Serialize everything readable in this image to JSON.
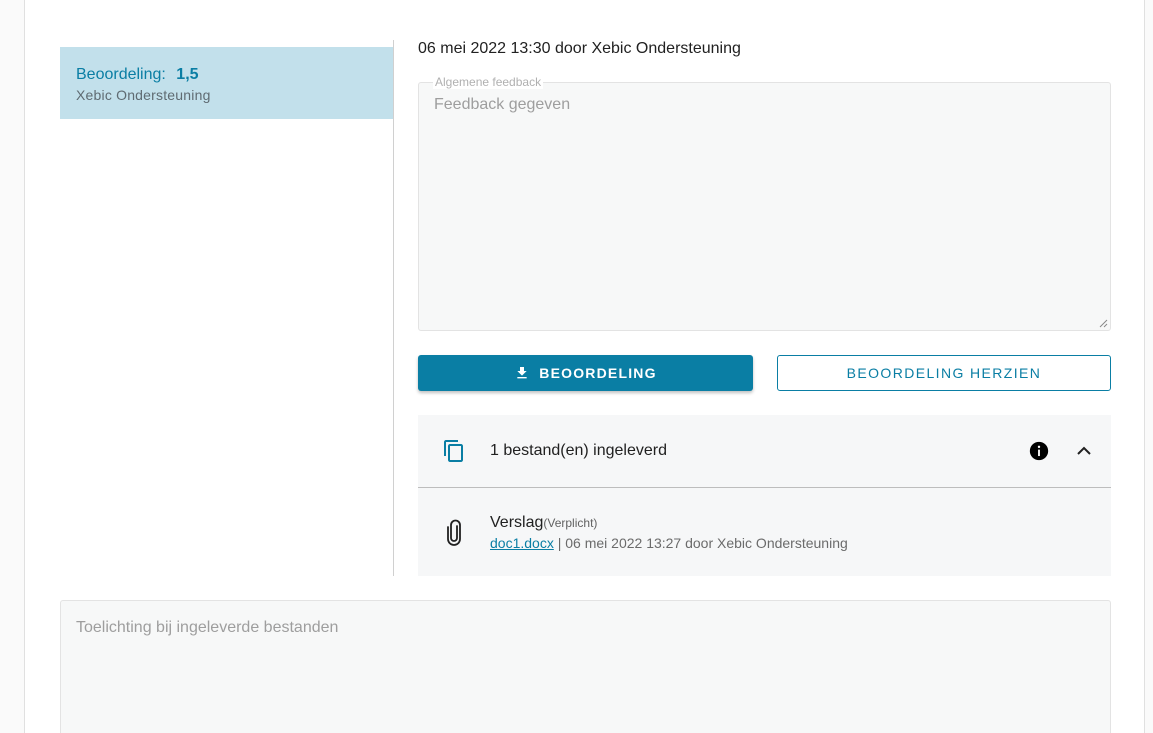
{
  "grading": {
    "label": "Beoordeling:",
    "value": "1,5",
    "grader": "Xebic Ondersteuning"
  },
  "meta": {
    "line": "06 mei 2022 13:30 door Xebic Ondersteuning"
  },
  "feedback": {
    "legend": "Algemene feedback",
    "text": "Feedback gegeven"
  },
  "buttons": {
    "download_label": "Beoordeling",
    "revise_label": "Beoordeling herzien"
  },
  "files": {
    "title": "1 bestand(en) ingeleverd",
    "items": [
      {
        "name": "Verslag",
        "required": "(Verplicht)",
        "filename": "doc1.docx",
        "detail": " | 06 mei 2022 13:27 door Xebic Ondersteuning"
      }
    ]
  },
  "notes": {
    "placeholder": "Toelichting bij ingeleverde bestanden"
  },
  "icons": {
    "download": "download-icon",
    "files": "copy-icon",
    "info": "info-icon",
    "chevron": "chevron-up-icon",
    "attachment": "paperclip-icon"
  },
  "colors": {
    "accent": "#0a7ea4",
    "selected_bg": "#c2e0eb"
  }
}
